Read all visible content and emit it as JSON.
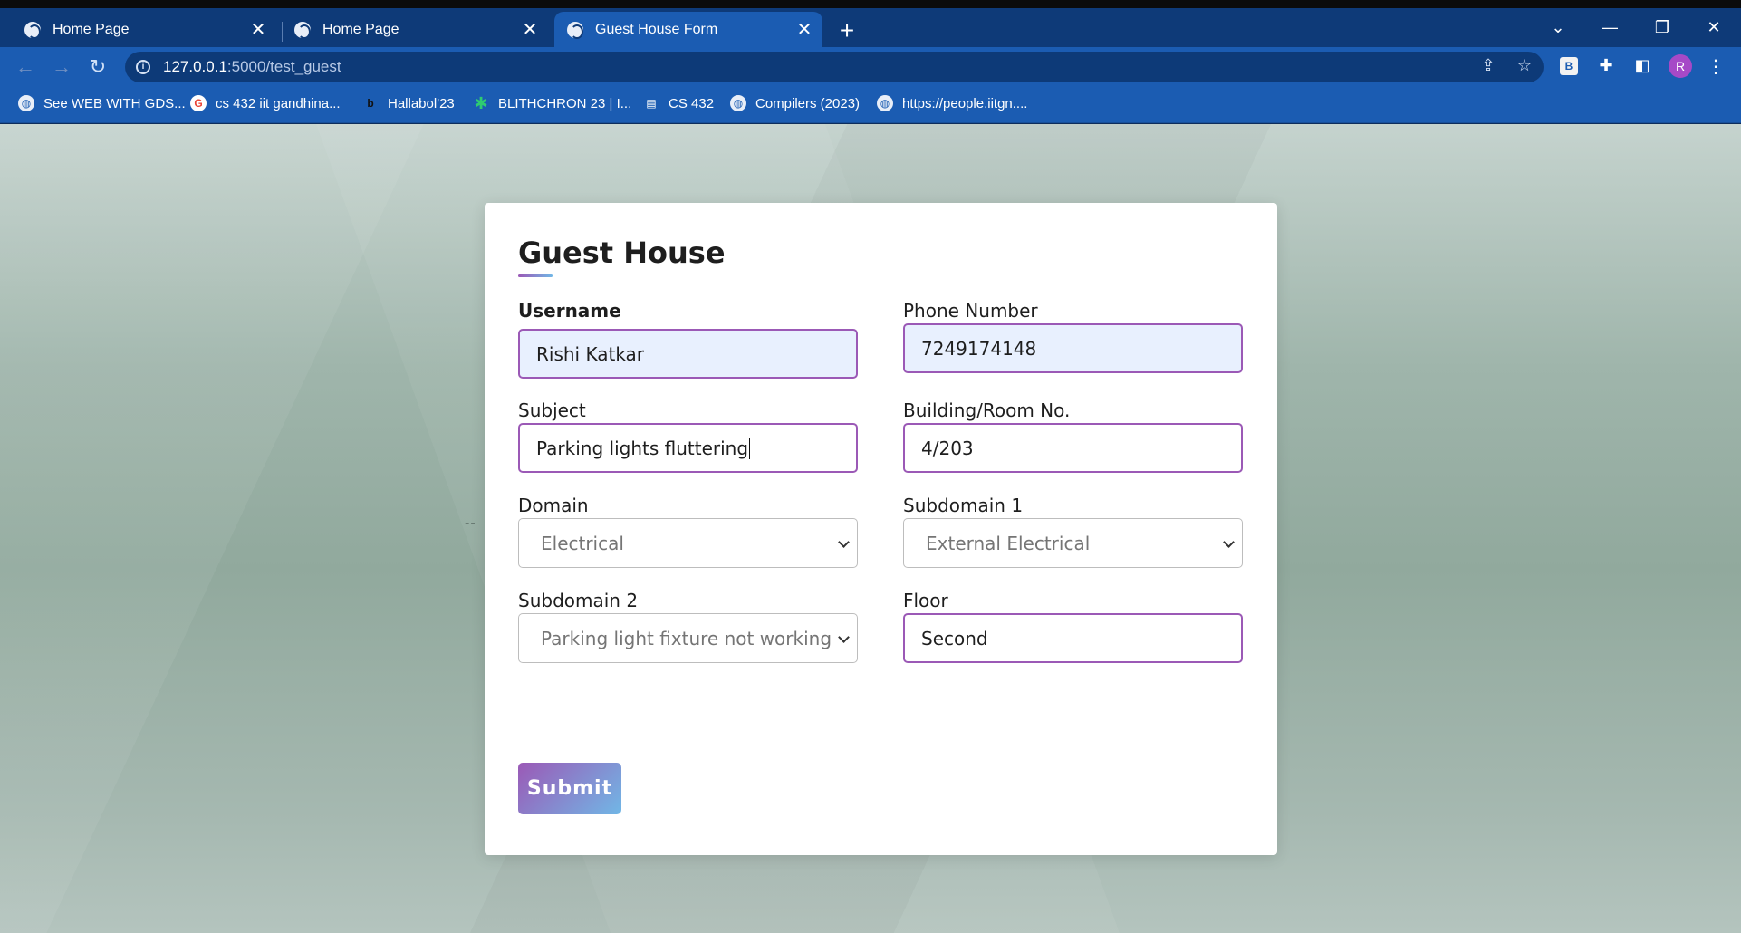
{
  "browser": {
    "tabs": [
      {
        "title": "Home Page",
        "active": false
      },
      {
        "title": "Home Page",
        "active": false
      },
      {
        "title": "Guest House Form",
        "active": true
      }
    ],
    "address": {
      "host": "127.0.0.1",
      "path": ":5000/test_guest"
    },
    "profile_initial": "R",
    "extension_badge": "B",
    "bookmarks": [
      {
        "label": "See WEB WITH GDS...",
        "icon": "globe-icon"
      },
      {
        "label": "cs 432 iit gandhina...",
        "icon": "google-icon"
      },
      {
        "label": "Hallabol'23",
        "icon": "b-logo-icon"
      },
      {
        "label": "BLITHCHRON 23 | I...",
        "icon": "star-burst-icon"
      },
      {
        "label": "CS 432",
        "icon": "board-icon"
      },
      {
        "label": "Compilers (2023)",
        "icon": "globe-icon"
      },
      {
        "label": "https://people.iitgn....",
        "icon": "globe-icon"
      }
    ]
  },
  "form": {
    "title": "Guest House",
    "username": {
      "label": "Username",
      "value": "Rishi Katkar"
    },
    "phone": {
      "label": "Phone Number",
      "value": "7249174148"
    },
    "subject": {
      "label": "Subject",
      "value": "Parking lights fluttering"
    },
    "room": {
      "label": "Building/Room No.",
      "value": "4/203"
    },
    "domain": {
      "label": "Domain",
      "selected": "Electrical"
    },
    "subdomain1": {
      "label": "Subdomain 1",
      "selected": "External Electrical"
    },
    "subdomain2": {
      "label": "Subdomain 2",
      "selected": "Parking light fixture not working"
    },
    "floor": {
      "label": "Floor",
      "value": "Second"
    },
    "submit_label": "Submit"
  },
  "colors": {
    "accent_start": "#9b59b6",
    "accent_end": "#71b7e6",
    "tab_strip": "#0e3a78",
    "toolbar": "#1b5cb2"
  }
}
